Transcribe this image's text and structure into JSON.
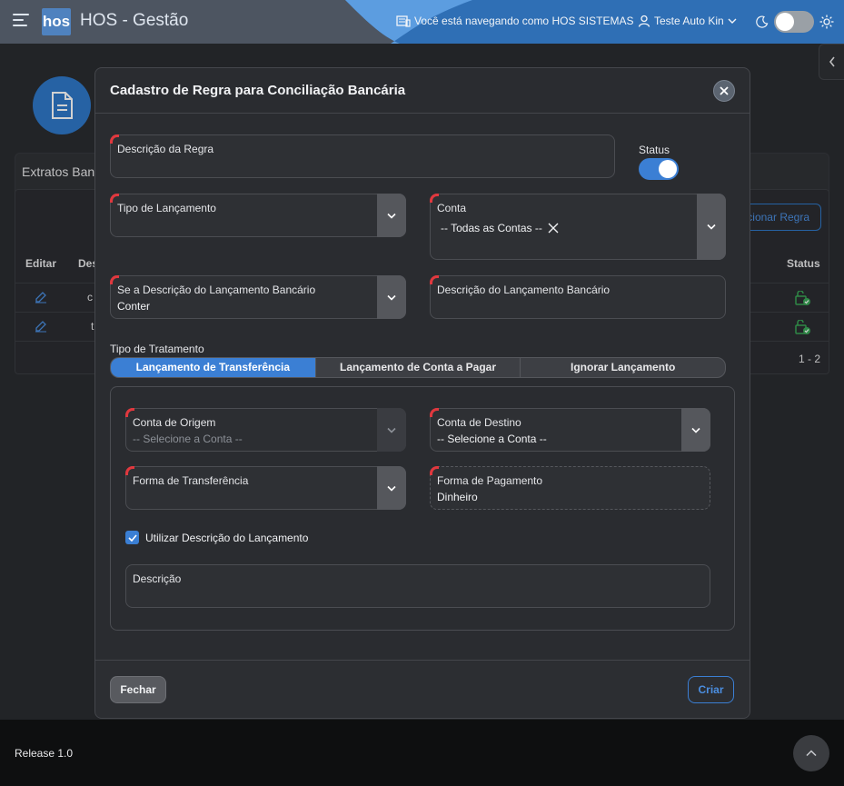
{
  "header": {
    "logo_text": "hos",
    "app_title": "HOS - Gestão",
    "navigating_as": "Você está navegando como HOS SISTEMAS",
    "user_name": "Teste Auto Kin"
  },
  "background": {
    "card_title": "Extratos Banc",
    "add_button": "cionar Regra",
    "columns": [
      "Editar",
      "Des",
      "Status"
    ],
    "rows": [
      {
        "desc": "c"
      },
      {
        "desc": "t"
      }
    ],
    "pager": "1 - 2"
  },
  "modal": {
    "title": "Cadastro de Regra para Conciliação Bancária",
    "descricao_regra": {
      "label": "Descrição da Regra",
      "value": ""
    },
    "status": {
      "label": "Status",
      "on": true
    },
    "tipo_lancamento": {
      "label": "Tipo de Lançamento",
      "value": ""
    },
    "conta": {
      "label": "Conta",
      "value": "-- Todas as Contas --"
    },
    "se_descricao": {
      "label": "Se a Descrição do Lançamento Bancário",
      "value": "Conter"
    },
    "descricao_lancamento": {
      "label": "Descrição do Lançamento Bancário",
      "value": ""
    },
    "tipo_tratamento": {
      "label": "Tipo de Tratamento",
      "tabs": [
        "Lançamento de Transferência",
        "Lançamento de Conta a Pagar",
        "Ignorar Lançamento"
      ],
      "active": 0
    },
    "conta_origem": {
      "label": "Conta de Origem",
      "placeholder": "-- Selecione a Conta --"
    },
    "conta_destino": {
      "label": "Conta de Destino",
      "value": "-- Selecione a Conta --"
    },
    "forma_transferencia": {
      "label": "Forma de Transferência",
      "value": ""
    },
    "forma_pagamento": {
      "label": "Forma de Pagamento",
      "value": "Dinheiro"
    },
    "utilizar_descricao": {
      "label": "Utilizar Descrição do Lançamento",
      "checked": true
    },
    "descricao": {
      "label": "Descrição",
      "value": ""
    },
    "fechar_label": "Fechar",
    "criar_label": "Criar"
  },
  "footer": {
    "release": "Release 1.0"
  },
  "colors": {
    "accent": "#3b7fd4",
    "required": "#e0383e",
    "status_ok": "#3aa657"
  }
}
